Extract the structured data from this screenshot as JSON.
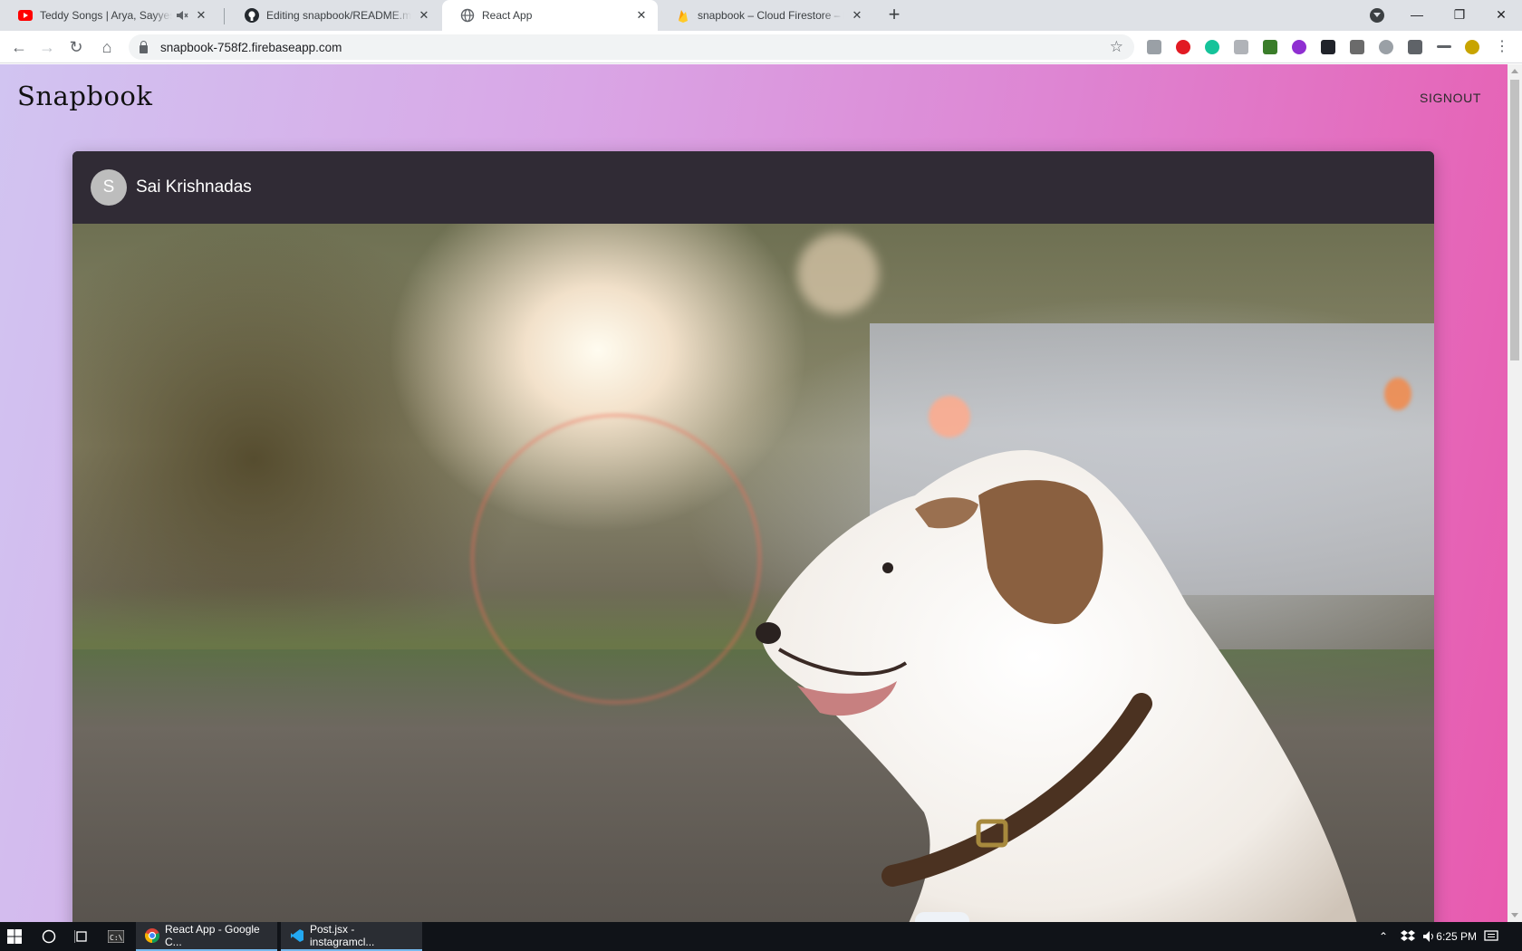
{
  "browser": {
    "tabs": [
      {
        "title": "Teddy Songs | Arya, Sayyesha",
        "icon": "youtube-icon",
        "muted": true,
        "active": false
      },
      {
        "title": "Editing snapbook/README.md at",
        "icon": "github-icon",
        "muted": false,
        "active": false
      },
      {
        "title": "React App",
        "icon": "globe-icon",
        "muted": false,
        "active": true
      },
      {
        "title": "snapbook – Cloud Firestore – Fire",
        "icon": "firebase-icon",
        "muted": false,
        "active": false
      }
    ],
    "new_tab_label": "+",
    "url": "snapbook-758f2.firebaseapp.com"
  },
  "app": {
    "brand": "Snapbook",
    "signout_label": "SIGNOUT",
    "post": {
      "avatar_letter": "S",
      "username": "Sai Krishnadas",
      "image_alt": "Dog with collar in sunlit street"
    }
  },
  "taskbar": {
    "apps": [
      {
        "label": "React App - Google C...",
        "icon": "chrome-icon"
      },
      {
        "label": "Post.jsx - instagramcl...",
        "icon": "vscode-icon"
      }
    ],
    "time": "6:25 PM"
  },
  "colors": {
    "gradient_start": "#d1c4f1",
    "gradient_end": "#e85aae",
    "card_header": "#302b35"
  }
}
